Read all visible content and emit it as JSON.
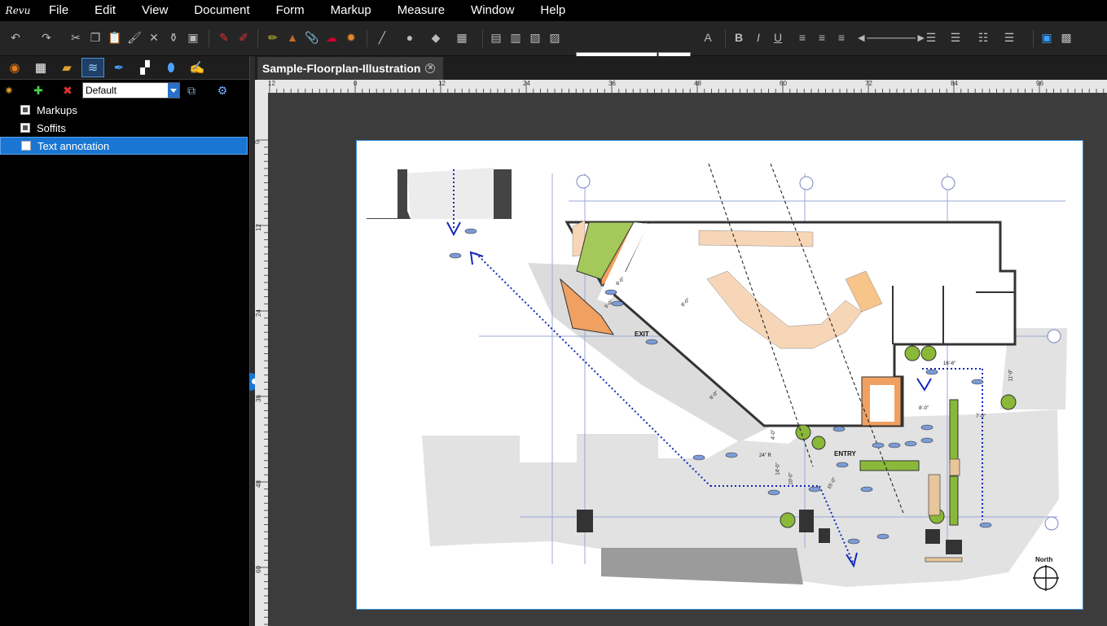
{
  "app": {
    "logo_text": "Revu"
  },
  "menu": [
    "File",
    "Edit",
    "View",
    "Document",
    "Form",
    "Markup",
    "Measure",
    "Window",
    "Help"
  ],
  "toolbar": {
    "font_size": "12"
  },
  "layers_panel": {
    "selected_layer_set": "Default",
    "layers": [
      {
        "label": "Markups",
        "checked": true
      },
      {
        "label": "Soffits",
        "checked": true
      },
      {
        "label": "Text annotation",
        "checked": false
      }
    ]
  },
  "document": {
    "tab_title": "Sample-Floorplan-Illustration"
  },
  "ruler": {
    "horizontal": [
      "12",
      "0",
      "12",
      "24",
      "36",
      "48",
      "60",
      "72",
      "84",
      "96"
    ],
    "vertical": [
      "0",
      "12",
      "24",
      "36",
      "48",
      "60"
    ]
  },
  "plan": {
    "exit_label": "EXIT",
    "entry_label": "ENTRY",
    "north_label": "North",
    "dims": [
      "16'-6\"",
      "11'-0\"",
      "8'-0\"",
      "7'-0\"",
      "6'-0\"",
      "5'-0\"",
      "8'-0\"",
      "6'-0\"",
      "4'-0\"",
      "24\" R",
      "14'-0\"",
      "10'-0\"",
      "15'-0\""
    ]
  }
}
